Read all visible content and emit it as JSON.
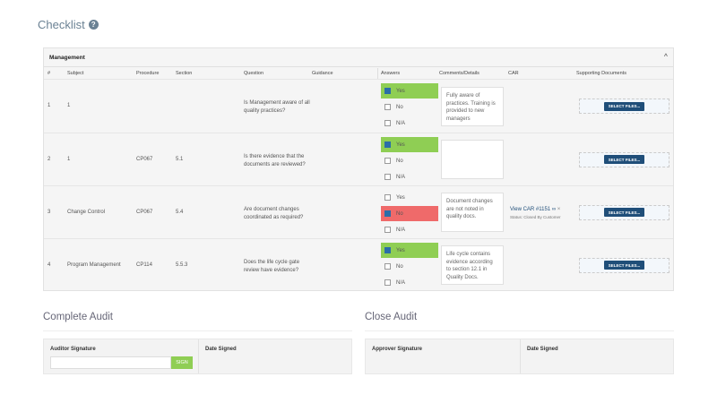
{
  "checklist": {
    "title": "Checklist",
    "help_icon": "?",
    "section": "Management",
    "columns": [
      "#",
      "Subject",
      "Procedure",
      "Section",
      "Question",
      "Guidance",
      "Answers",
      "Comments/Details",
      "CAR",
      "Supporting Documents"
    ],
    "rows": [
      {
        "num": "1",
        "subject": "1",
        "procedure": "",
        "section": "",
        "question": "Is Management aware of all quality practices?",
        "answer": "Yes",
        "comment": "Fully aware of practices. Training is provided to new managers",
        "car_link": "",
        "car_status": ""
      },
      {
        "num": "2",
        "subject": "1",
        "procedure": "CP067",
        "section": "5.1",
        "question": "Is there evidence that the documents are reviewed?",
        "answer": "Yes",
        "comment": "",
        "car_link": "",
        "car_status": ""
      },
      {
        "num": "3",
        "subject": "Change Control",
        "procedure": "CP067",
        "section": "5.4",
        "question": "Are document changes coordinated as required?",
        "answer": "No",
        "comment": "Document changes are not noted in quality docs.",
        "car_link": "View CAR #1151",
        "car_status": "Status: Closed By Customer"
      },
      {
        "num": "4",
        "subject": "Program Management",
        "procedure": "CP114",
        "section": "5.5.3",
        "question": "Does the life cycle gate review have evidence?",
        "answer": "Yes",
        "comment": "Life cycle contains evidence according to section 12.1 in Quality Docs.",
        "car_link": "",
        "car_status": ""
      }
    ],
    "options": [
      "Yes",
      "No",
      "N/A"
    ],
    "select_files_label": "SELECT FILES..."
  },
  "complete_audit": {
    "title": "Complete Audit",
    "signature_label": "Auditor Signature",
    "signature_value": "",
    "sign_label": "SIGN",
    "date_label": "Date Signed"
  },
  "close_audit": {
    "title": "Close Audit",
    "signature_label": "Approver Signature",
    "date_label": "Date Signed"
  },
  "colors": {
    "yes": "#8fce54",
    "no": "#ef6a6a",
    "button": "#1f4e79",
    "link": "#1f4e79"
  }
}
